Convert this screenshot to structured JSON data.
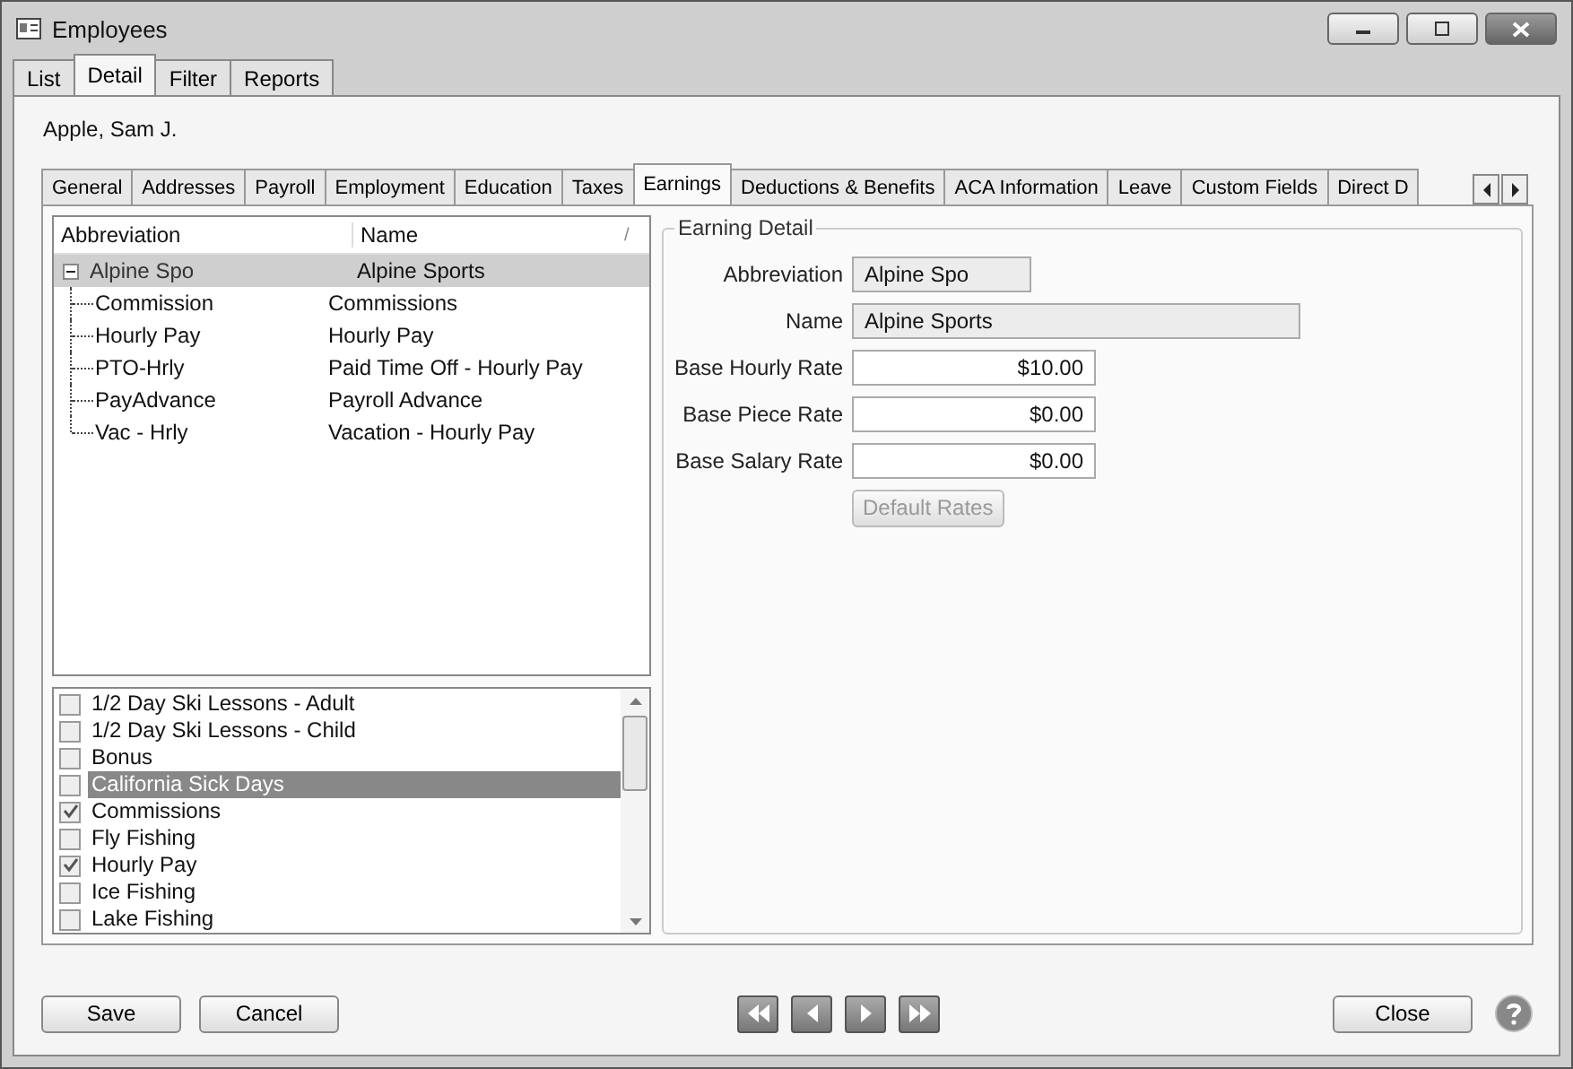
{
  "window": {
    "title": "Employees"
  },
  "top_tabs": [
    {
      "label": "List",
      "selected": false
    },
    {
      "label": "Detail",
      "selected": true
    },
    {
      "label": "Filter",
      "selected": false
    },
    {
      "label": "Reports",
      "selected": false
    }
  ],
  "employee_name": "Apple, Sam J.",
  "detail_tabs": [
    {
      "label": "General",
      "selected": false
    },
    {
      "label": "Addresses",
      "selected": false
    },
    {
      "label": "Payroll",
      "selected": false
    },
    {
      "label": "Employment",
      "selected": false
    },
    {
      "label": "Education",
      "selected": false
    },
    {
      "label": "Taxes",
      "selected": false
    },
    {
      "label": "Earnings",
      "selected": true
    },
    {
      "label": "Deductions & Benefits",
      "selected": false
    },
    {
      "label": "ACA Information",
      "selected": false
    },
    {
      "label": "Leave",
      "selected": false
    },
    {
      "label": "Custom Fields",
      "selected": false
    },
    {
      "label": "Direct D",
      "selected": false
    }
  ],
  "tree": {
    "columns": [
      "Abbreviation",
      "Name",
      "/"
    ],
    "rows": [
      {
        "abbreviation": "Alpine Spo",
        "name": "Alpine Sports",
        "selected": true,
        "expanded": true,
        "children": [
          {
            "abbreviation": "Commission",
            "name": "Commissions",
            "selected": false
          },
          {
            "abbreviation": "Hourly Pay",
            "name": "Hourly Pay",
            "selected": false
          },
          {
            "abbreviation": "PTO-Hrly",
            "name": "Paid Time Off - Hourly Pay",
            "selected": false
          },
          {
            "abbreviation": "PayAdvance",
            "name": "Payroll Advance",
            "selected": false
          },
          {
            "abbreviation": "Vac - Hrly",
            "name": "Vacation - Hourly Pay",
            "selected": false
          }
        ]
      }
    ]
  },
  "checklist": [
    {
      "label": "1/2 Day Ski Lessons - Adult",
      "checked": false,
      "selected": false
    },
    {
      "label": "1/2 Day Ski Lessons - Child",
      "checked": false,
      "selected": false
    },
    {
      "label": "Bonus",
      "checked": false,
      "selected": false
    },
    {
      "label": "California Sick Days",
      "checked": false,
      "selected": true
    },
    {
      "label": "Commissions",
      "checked": true,
      "selected": false
    },
    {
      "label": "Fly Fishing",
      "checked": false,
      "selected": false
    },
    {
      "label": "Hourly Pay",
      "checked": true,
      "selected": false
    },
    {
      "label": "Ice Fishing",
      "checked": false,
      "selected": false
    },
    {
      "label": "Lake Fishing",
      "checked": false,
      "selected": false
    }
  ],
  "detail": {
    "title": "Earning Detail",
    "fields": [
      {
        "label": "Abbreviation",
        "value": "Alpine Spo",
        "kind": "readonly"
      },
      {
        "label": "Name",
        "value": "Alpine Sports",
        "kind": "readonly"
      },
      {
        "label": "Base Hourly Rate",
        "value": "$10.00",
        "kind": "amount"
      },
      {
        "label": "Base Piece Rate",
        "value": "$0.00",
        "kind": "amount"
      },
      {
        "label": "Base Salary Rate",
        "value": "$0.00",
        "kind": "amount"
      }
    ],
    "button": {
      "label": "Default Rates",
      "disabled": true
    }
  },
  "footer": {
    "save": "Save",
    "cancel": "Cancel",
    "close": "Close"
  }
}
